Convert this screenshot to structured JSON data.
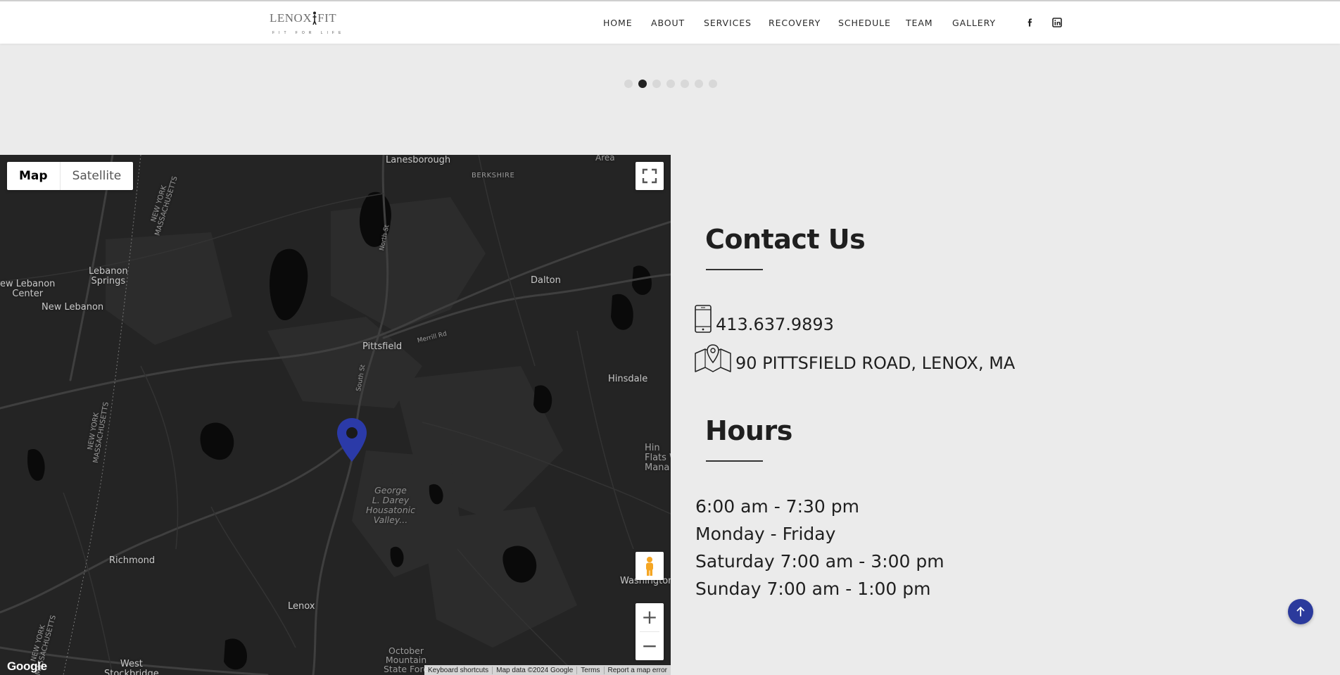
{
  "header": {
    "logo": {
      "text_left": "LENOX",
      "text_right": "FIT",
      "tagline": "FIT FOR LIFE"
    },
    "nav": [
      "HOME",
      "ABOUT",
      "SERVICES",
      "RECOVERY",
      "SCHEDULE",
      "TEAM",
      "GALLERY"
    ],
    "social": [
      {
        "icon": "facebook-icon",
        "glyph": "f"
      },
      {
        "icon": "linkedin-icon",
        "glyph": "in"
      }
    ]
  },
  "carousel": {
    "dot_count": 7,
    "active_index": 1
  },
  "map": {
    "type_controls": {
      "map": "Map",
      "satellite": "Satellite",
      "selected": "Map"
    },
    "labels": {
      "lanesborough": "Lanesborough",
      "berkshire": "BERKSHIRE",
      "area": "Area",
      "ny_ma_top": "NEW YORK\nMASSACHUSETTS",
      "lebanon_springs": "Lebanon\nSprings",
      "new_lebanon_center": "ew Lebanon\nCenter",
      "new_lebanon": "New Lebanon",
      "dalton": "Dalton",
      "north_st": "North St",
      "merrill_rd": "Merrill Rd",
      "pittsfield": "Pittsfield",
      "south_st": "South St",
      "hinsdale": "Hinsdale",
      "ny_ma_mid": "NEW YORK\nMASSACHUSETTS",
      "george_darey": "George\nL. Darey\nHousatonic\nValley...",
      "hinsdale_flats": "Hin\nFlats W\nMana",
      "richmond": "Richmond",
      "washington": "Washington",
      "lenox": "Lenox",
      "ny_ma_bottom": "NEW YORK\nMASSACHUSETTS",
      "west_stockbridge": "West\nStockbridge",
      "october_mountain": "October\nMountain\nState Fore"
    },
    "google_logo": "Google",
    "attribution": [
      "Keyboard shortcuts",
      "Map data ©2024 Google",
      "Terms",
      "Report a map error"
    ],
    "marker_color": "#2b3aa8",
    "zoom_in": "+",
    "zoom_out": "−"
  },
  "contact": {
    "title": "Contact Us",
    "phone": "413.637.9893",
    "address": "90 PITTSFIELD ROAD, LENOX, MA"
  },
  "hours": {
    "title": "Hours",
    "lines": [
      "6:00 am - 7:30 pm",
      "Monday - Friday",
      "Saturday 7:00 am - 3:00 pm",
      "Sunday 7:00 am - 1:00 pm"
    ]
  },
  "colors": {
    "accent": "#2b3a9c",
    "page_bg": "#ebebeb",
    "map_bg": "#242424"
  }
}
